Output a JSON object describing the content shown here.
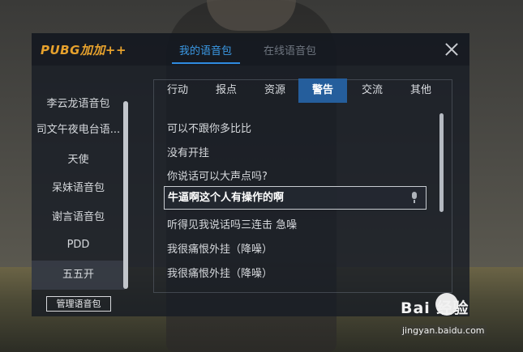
{
  "header": {
    "logo": "PUBG加加++",
    "tabs": [
      {
        "label": "我的语音包",
        "active": true
      },
      {
        "label": "在线语音包",
        "active": false
      }
    ],
    "close_icon": "close-icon"
  },
  "sidebar": {
    "items": [
      {
        "label": "李云龙语音包"
      },
      {
        "label": "司文午夜电台语..."
      },
      {
        "label": "天使"
      },
      {
        "label": "呆妹语音包"
      },
      {
        "label": "谢言语音包"
      },
      {
        "label": "PDD"
      },
      {
        "label": "五五开",
        "active": true
      }
    ],
    "manage_button": "管理语音包"
  },
  "categories": [
    {
      "label": "行动"
    },
    {
      "label": "报点"
    },
    {
      "label": "资源"
    },
    {
      "label": "警告",
      "active": true
    },
    {
      "label": "交流"
    },
    {
      "label": "其他"
    }
  ],
  "phrases": [
    {
      "text": "可以不跟你多比比"
    },
    {
      "text": "没有开挂"
    },
    {
      "text": "你说话可以大声点吗?"
    },
    {
      "text": "牛逼啊这个人有操作的啊",
      "selected": true
    },
    {
      "text": "听得见我说话吗三连击 急噪"
    },
    {
      "text": "我很痛恨外挂（降噪）"
    },
    {
      "text": "我很痛恨外挂（降噪）"
    }
  ],
  "watermark": {
    "brand": "Bai 经验",
    "url": "jingyan.baidu.com"
  },
  "colors": {
    "accent": "#2f8be0",
    "logo": "#e7a22d",
    "active_category": "#255e9c"
  }
}
